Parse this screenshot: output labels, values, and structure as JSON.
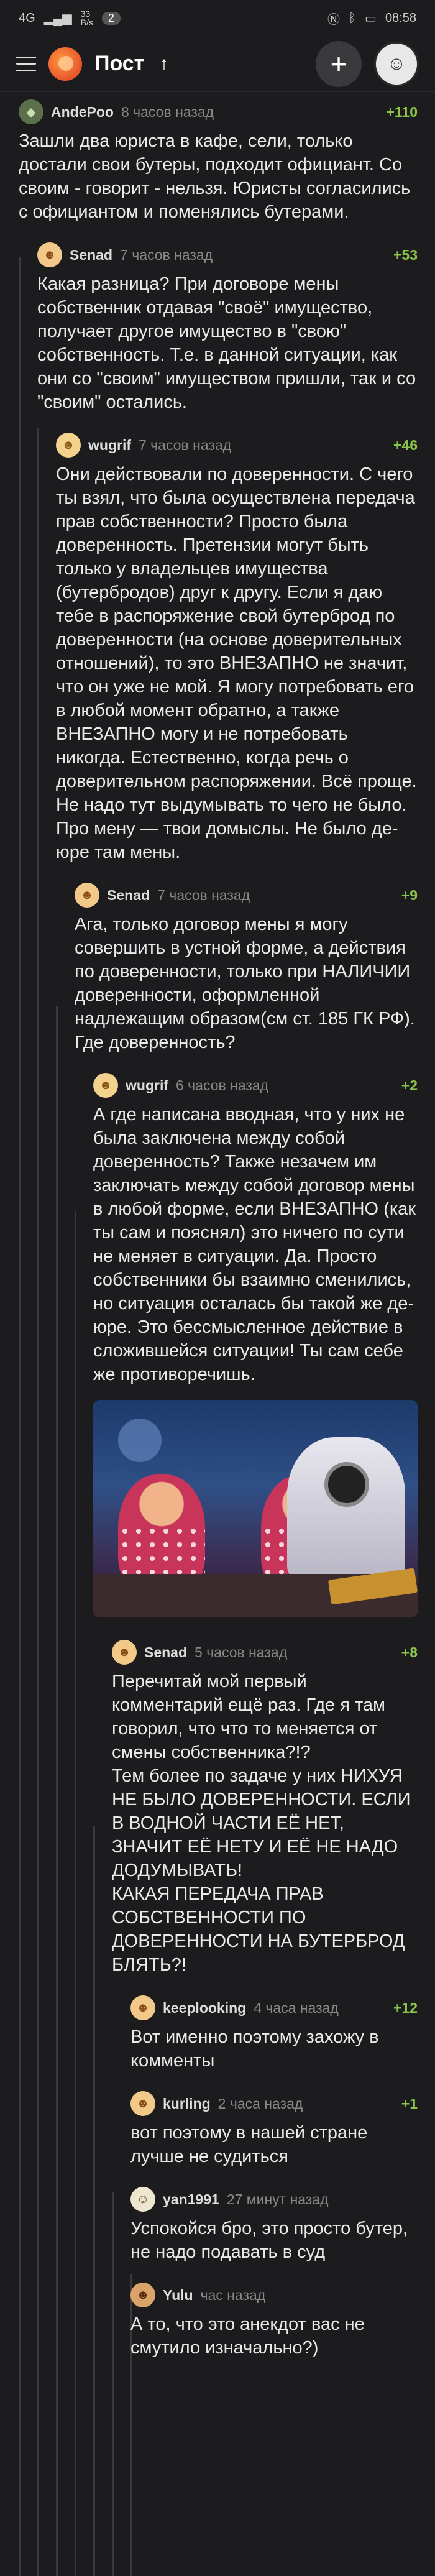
{
  "status_bar": {
    "signal": "4G",
    "speed": "33\nB/s",
    "badge": "2",
    "time": "08:58",
    "icons": [
      "nfc-icon",
      "bluetooth-icon",
      "battery-icon"
    ]
  },
  "app_bar": {
    "title": "Пост",
    "back_icon": "arrow-up-icon",
    "add_label": "+"
  },
  "comments": [
    {
      "author": "AndePoo",
      "time": "8 часов назад",
      "rating": "+110",
      "text": "Зашли два юриста в кафе, сели, только достали свои бутеры, подходит официант. Со своим - говорит - нельзя. Юристы согласились с официантом и поменялись бутерами."
    },
    {
      "author": "Senad",
      "time": "7 часов назад",
      "rating": "+53",
      "text": "Какая разница? При договоре мены собственник отдавая \"своё\" имущество, получает другое имущество в \"свою\" собственность. Т.е. в данной ситуации, как они со \"своим\" имуществом пришли, так и со \"своим\" остались."
    },
    {
      "author": "wugrif",
      "time": "7 часов назад",
      "rating": "+46",
      "text": "Они действовали по доверенности. С чего ты взял, что была осуществлена передача прав собственности? Просто была доверенность. Претензии могут быть только у владельцев имущества (бутербродов) друг к другу. Если я даю тебе в распоряжение свой бутерброд по доверенности (на основе доверительных отношений), то это ВНЕЗАПНО не значит, что он уже не мой. Я могу потребовать его в любой момент обратно, а также ВНЕЗАПНО могу и не потребовать никогда. Естественно, когда речь о доверительном распоряжении. Всё проще. Не надо тут выдумывать то чего не было. Про мену — твои домыслы. Не было де-юре там мены."
    },
    {
      "author": "Senad",
      "time": "7 часов назад",
      "rating": "+9",
      "text": "Ага, только договор мены я могу совершить в устной форме, а действия по доверенности, только при НАЛИЧИИ доверенности, оформленной надлежащим образом(см ст. 185 ГК РФ). Где доверенность?"
    },
    {
      "author": "wugrif",
      "time": "6 часов назад",
      "rating": "+2",
      "text": "А где написана вводная, что у них не была заключена между собой доверенность? Также незачем им заключать между собой договор мены в любой форме, если ВНЕЗАПНО (как ты сам и пояснял) это ничего по сути не меняет в ситуации. Да. Просто собственники бы взаимно сменились, но ситуация осталась бы такой же де-юре. Это бессмысленное действие в сложившейся ситуации! Ты сам себе же противоречишь."
    },
    {
      "author": "Senad",
      "time": "5 часов назад",
      "rating": "+8",
      "text": "Перечитай мой первый комментарий ещё раз. Где я там говорил, что что то меняется от смены собственника?!?\nТем более по задаче у них НИХУЯ НЕ БЫЛО ДОВЕРЕННОСТИ. ЕСЛИ В ВОДНОЙ ЧАСТИ ЕЁ НЕТ, ЗНАЧИТ ЕЁ НЕТУ И ЕЁ НЕ НАДО ДОДУМЫВАТЬ!\nКАКАЯ ПЕРЕДАЧА ПРАВ СОБСТВЕННОСТИ ПО ДОВЕРЕННОСТИ НА БУТЕРБРОД БЛЯТЬ?!"
    },
    {
      "author": "keeplooking",
      "time": "4 часа назад",
      "rating": "+12",
      "text": "Вот именно поэтому захожу в комменты"
    },
    {
      "author": "kurling",
      "time": "2 часа назад",
      "rating": "+1",
      "text": "вот поэтому в нашей стране лучше не судиться"
    },
    {
      "author": "yan1991",
      "time": "27 минут назад",
      "rating": "",
      "text": "Успокойся бро, это просто бутер, не надо подавать в суд"
    },
    {
      "author": "Yulu",
      "time": "час назад",
      "rating": "",
      "text": "А то, что это анекдот вас не смутило изначально?)"
    }
  ],
  "colors": {
    "background": "#1c1c1e",
    "rating": "#8ac44a",
    "thread_line": "#3a3a3c"
  }
}
